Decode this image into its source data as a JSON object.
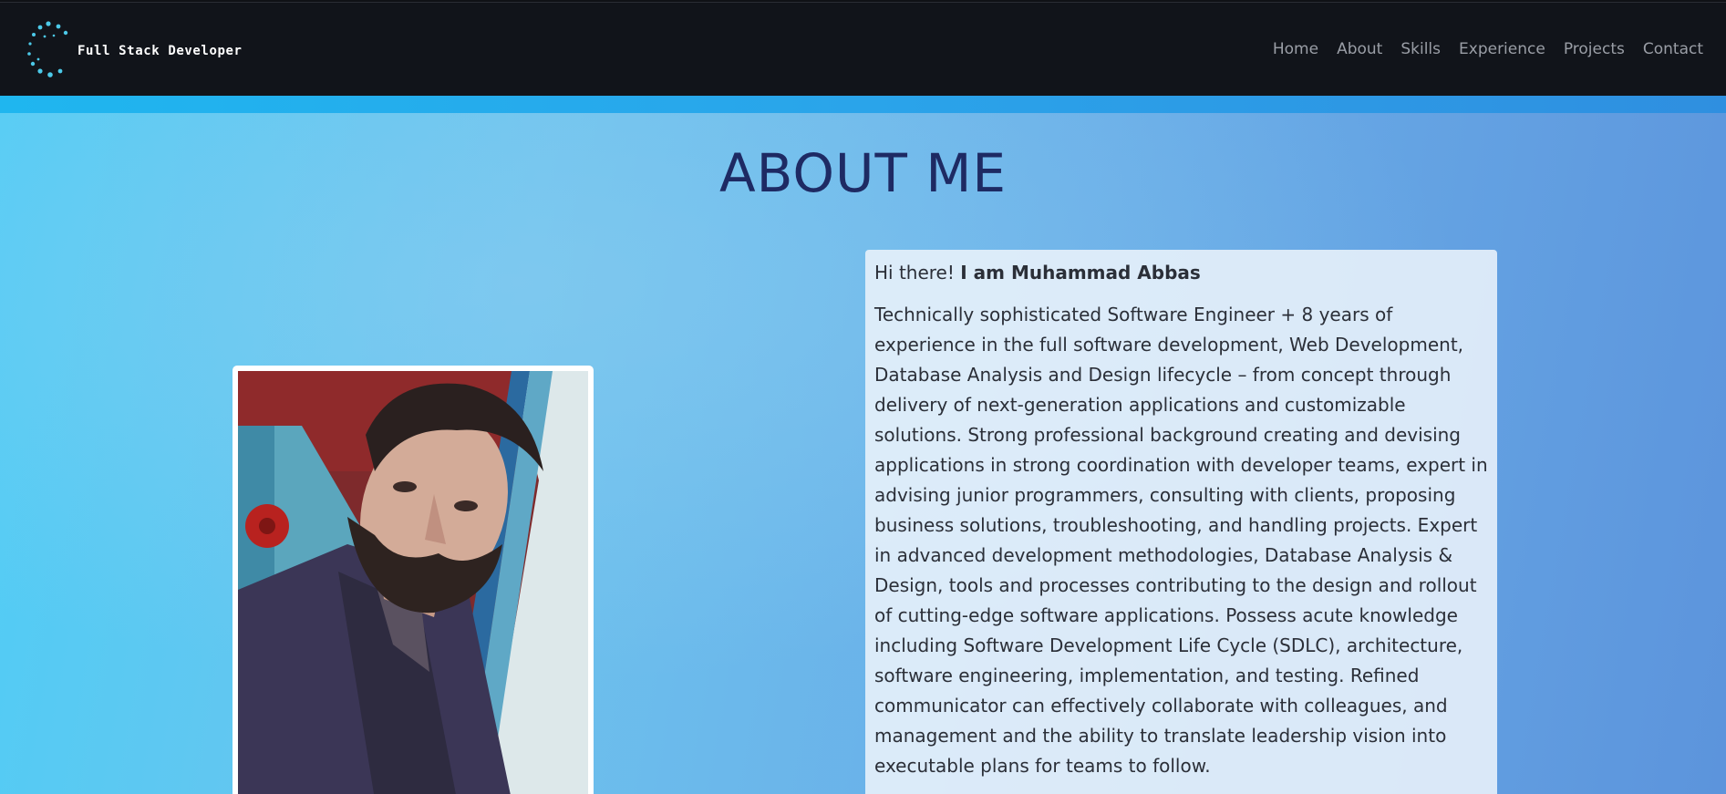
{
  "navbar": {
    "brand": "Full Stack Developer",
    "logo_icon": "dotted-circle-spinner-icon",
    "items": [
      "Home",
      "About",
      "Skills",
      "Experience",
      "Projects",
      "Contact"
    ]
  },
  "about": {
    "title": "ABOUT ME",
    "greeting_prefix": "Hi there! ",
    "greeting_name": "I am Muhammad Abbas",
    "bio": "Technically sophisticated Software Engineer + 8 years of experience in the full software development, Web Development, Database Analysis and Design lifecycle – from concept through delivery of next-generation applications and customizable solutions. Strong professional background creating and devising applications in strong coordination with developer teams, expert in advising junior programmers, consulting with clients, proposing business solutions, troubleshooting, and handling projects. Expert in advanced development methodologies, Database Analysis & Design, tools and processes contributing to the design and rollout of cutting-edge software applications. Possess acute knowledge including Software Development Life Cycle (SDLC), architecture, software engineering, implementation, and testing. Refined communicator can effectively collaborate with colleagues, and management and the ability to translate leadership vision into executable plans for teams to follow."
  },
  "colors": {
    "navbar_bg": "#11141a",
    "accent": "#1fb6ef",
    "title": "#1e2a63",
    "logo_dots": "#4cc9e8"
  }
}
